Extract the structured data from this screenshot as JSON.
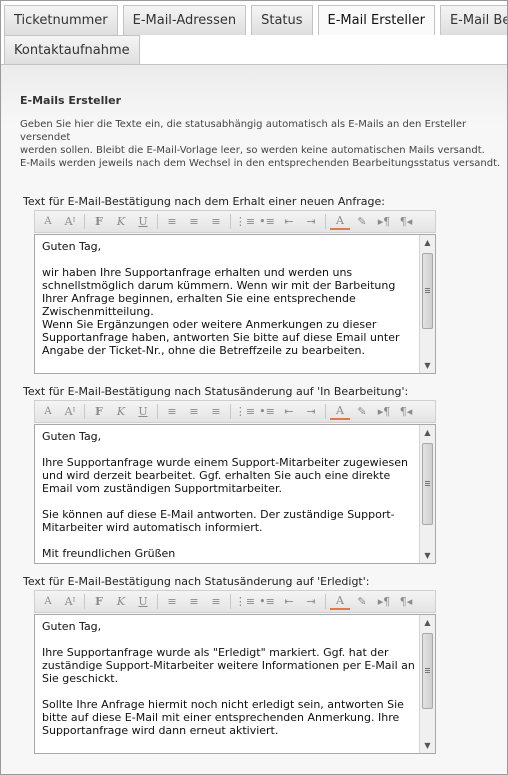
{
  "tabs_row1": [
    {
      "label": "Ticketnummer",
      "active": false
    },
    {
      "label": "E-Mail-Adressen",
      "active": false
    },
    {
      "label": "Status",
      "active": false
    },
    {
      "label": "E-Mail Ersteller",
      "active": true
    },
    {
      "label": "E-Mail Bea",
      "active": false
    }
  ],
  "tabs_row2": [
    {
      "label": "Kontaktaufnahme",
      "active": false
    }
  ],
  "page": {
    "title": "E-Mails Ersteller",
    "description_line1": "Geben Sie hier die Texte ein, die statusabhängig automatisch als E-Mails an den Ersteller versendet",
    "description_line2": "werden sollen. Bleibt die E-Mail-Vorlage leer, so werden keine automatischen Mails versandt.",
    "description_line3": "E-Mails werden jeweils nach dem Wechsel in den entsprechenden Bearbeitungsstatus versandt."
  },
  "toolbar_buttons": [
    {
      "icon": "font-size-decrease-icon",
      "glyph": "A"
    },
    {
      "icon": "font-size-increase-icon",
      "glyph": "Aᴵ"
    },
    {
      "sep": true
    },
    {
      "icon": "bold-icon",
      "glyph": "F"
    },
    {
      "icon": "italic-icon",
      "glyph": "K"
    },
    {
      "icon": "underline-icon",
      "glyph": "U"
    },
    {
      "sep": true
    },
    {
      "icon": "align-left-icon",
      "glyph": "≡"
    },
    {
      "icon": "align-center-icon",
      "glyph": "≡"
    },
    {
      "icon": "align-right-icon",
      "glyph": "≡"
    },
    {
      "sep": true
    },
    {
      "icon": "ordered-list-icon",
      "glyph": "⋮≡"
    },
    {
      "icon": "unordered-list-icon",
      "glyph": "•≡"
    },
    {
      "icon": "outdent-icon",
      "glyph": "⇤"
    },
    {
      "icon": "indent-icon",
      "glyph": "⇥"
    },
    {
      "sep": true
    },
    {
      "icon": "font-color-icon",
      "glyph": "A"
    },
    {
      "icon": "highlight-icon",
      "glyph": "✎"
    },
    {
      "icon": "ltr-icon",
      "glyph": "▸¶"
    },
    {
      "icon": "rtl-icon",
      "glyph": "¶◂"
    }
  ],
  "editors": [
    {
      "label": "Text für E-Mail-Bestätigung nach dem Erhalt einer neuen Anfrage:",
      "paragraphs": [
        "Guten Tag,",
        "wir haben Ihre Supportanfrage erhalten und werden uns schnellstmöglich darum kümmern. Wenn wir mit der Barbeitung Ihrer Anfrage beginnen, erhalten Sie eine entsprechende Zwischenmitteilung.\nWenn Sie Ergänzungen oder weitere Anmerkungen zu dieser Supportanfrage haben, antworten Sie bitte auf diese Email unter Angabe der Ticket-Nr., ohne die Betreffzeile zu bearbeiten."
      ]
    },
    {
      "label": "Text für E-Mail-Bestätigung nach Statusänderung auf 'In Bearbeitung':",
      "paragraphs": [
        "Guten Tag,",
        "Ihre Supportanfrage wurde einem Support-Mitarbeiter zugewiesen und wird derzeit bearbeitet. Ggf. erhalten Sie auch eine direkte Email vom zuständigen Supportmitarbeiter.",
        "Sie können auf diese E-Mail antworten. Der zuständige Support-Mitarbeiter wird automatisch informiert.",
        "Mit freundlichen Grüßen"
      ]
    },
    {
      "label": "Text für E-Mail-Bestätigung nach Statusänderung auf 'Erledigt':",
      "paragraphs": [
        "Guten Tag,",
        "Ihre Supportanfrage wurde als \"Erledigt\" markiert. Ggf. hat der zuständige Support-Mitarbeiter weitere Informationen per E-Mail an Sie geschickt.",
        "Sollte Ihre Anfrage hiermit noch nicht erledigt sein, antworten Sie bitte auf diese E-Mail mit einer entsprechenden Anmerkung. Ihre Supportanfrage wird dann erneut aktiviert."
      ]
    }
  ]
}
